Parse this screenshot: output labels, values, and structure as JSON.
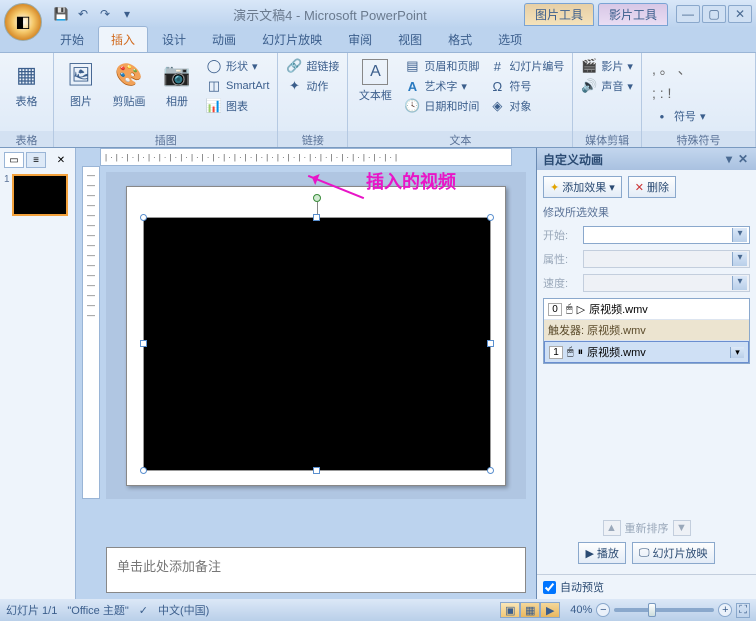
{
  "title": "演示文稿4 - Microsoft PowerPoint",
  "contextual": {
    "picture": "图片工具",
    "movie": "影片工具"
  },
  "tabs": {
    "home": "开始",
    "insert": "插入",
    "design": "设计",
    "anim": "动画",
    "slideshow": "幻灯片放映",
    "review": "审阅",
    "view": "视图",
    "format": "格式",
    "options": "选项"
  },
  "ribbon": {
    "tables": {
      "label": "表格",
      "table": "表格"
    },
    "illus": {
      "label": "插图",
      "picture": "图片",
      "clipart": "剪贴画",
      "album": "相册",
      "shapes": "形状",
      "smartart": "SmartArt",
      "chart": "图表"
    },
    "links": {
      "label": "链接",
      "hyperlink": "超链接",
      "action": "动作"
    },
    "text": {
      "label": "文本",
      "textbox": "文本框",
      "headerfooter": "页眉和页脚",
      "wordart": "艺术字",
      "datetime": "日期和时间",
      "slidenum": "幻灯片编号",
      "symbol": "符号",
      "object": "对象"
    },
    "media": {
      "label": "媒体剪辑",
      "movie": "影片",
      "sound": "声音"
    },
    "special": {
      "label": "特殊符号",
      "symbol": "符号"
    }
  },
  "annotation": "插入的视频",
  "notes_placeholder": "单击此处添加备注",
  "taskpane": {
    "title": "自定义动画",
    "add_effect": "添加效果",
    "remove": "删除",
    "modify": "修改所选效果",
    "start": "开始:",
    "property": "属性:",
    "speed": "速度:",
    "item0": "原视频.wmv",
    "trigger": "触发器: 原视频.wmv",
    "item1": "原视频.wmv",
    "reorder": "重新排序",
    "play": "播放",
    "slideshow": "幻灯片放映",
    "autopreview": "自动预览"
  },
  "status": {
    "slide": "幻灯片 1/1",
    "theme": "\"Office 主题\"",
    "lang": "中文(中国)",
    "zoom": "40%"
  }
}
